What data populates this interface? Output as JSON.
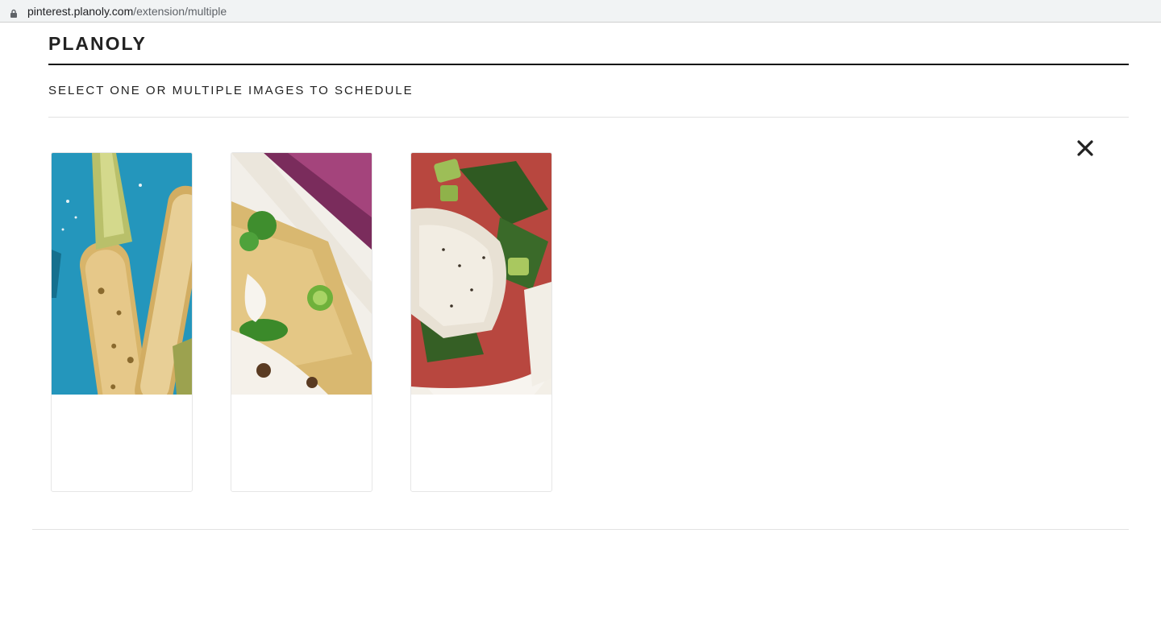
{
  "browser": {
    "url_host": "pinterest.planoly.com",
    "url_path": "/extension/multiple"
  },
  "header": {
    "brand": "PLANOLY",
    "subtitle": "SELECT ONE OR MULTIPLE IMAGES TO SCHEDULE"
  },
  "images": [
    {
      "icon": "grilled-corn-image"
    },
    {
      "icon": "taco-image"
    },
    {
      "icon": "fish-vegetables-image"
    }
  ],
  "colors": {
    "accent": "#111111",
    "divider": "#e2e2e2"
  }
}
